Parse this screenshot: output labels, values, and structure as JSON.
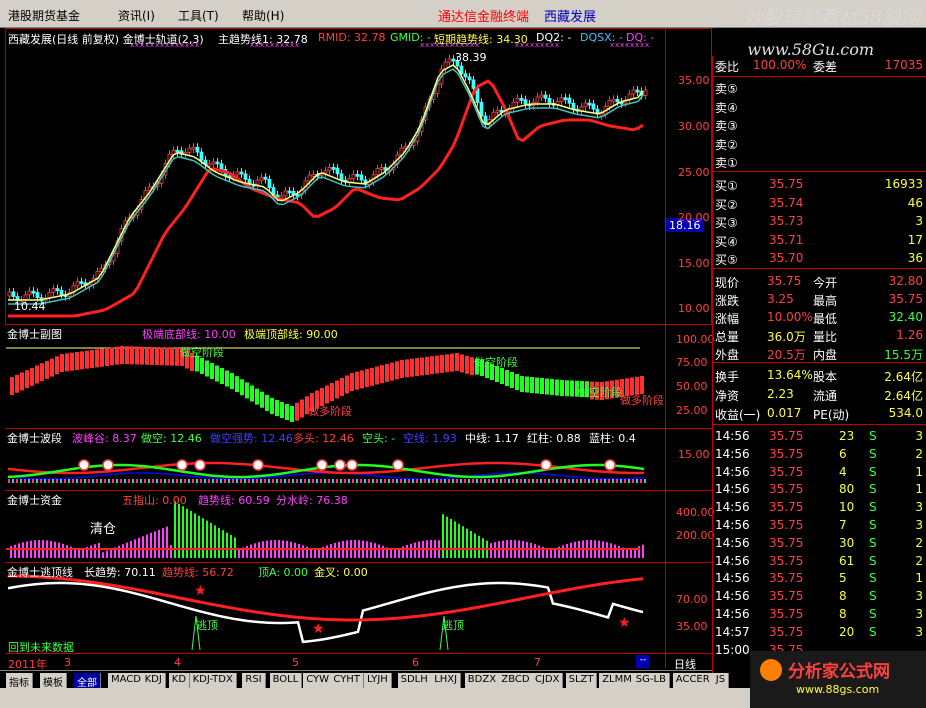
{
  "menu": {
    "items": [
      "港股期货基金",
      "资讯(I)",
      "工具(T)",
      "帮助(H)"
    ],
    "title_red": "通达信金融终端",
    "title_blue": "西藏发展"
  },
  "watermark": {
    "top": "炒股辅助教材58股网",
    "url": "www.58Gu.com",
    "logo_cn": "分析家公式网",
    "logo_url": "www.88gs.com"
  },
  "main_panel": {
    "title": "西藏发展(日线 前复权) 金博士轨道(2,3)",
    "trend_label": "主趋势线1: 32.78",
    "rmid": "RMID: 32.78",
    "gmid": "GMID: -",
    "short_trend": "短期趋势线: 34.30",
    "dq2": "DQ2: -",
    "dqsx": "DQSX: -",
    "dq": "DQ: -",
    "peak": "38.39",
    "low": "10.44",
    "price_marker": "18.16",
    "y_ticks": [
      "35.00",
      "30.00",
      "25.00",
      "20.00",
      "15.00",
      "10.00"
    ]
  },
  "sub1": {
    "title": "金博士副图",
    "low_line": "极端底部线: 10.00",
    "high_line": "极端顶部线: 90.00",
    "ann_empty1": "做空阶段",
    "ann_empty2": "做空阶段",
    "ann_empty3": "做空阶段",
    "ann_long1": "做多阶段",
    "ann_long2": "做多阶段",
    "y_ticks": [
      "100.00",
      "75.00",
      "50.00",
      "25.00"
    ]
  },
  "sub2": {
    "title": "金博士波段",
    "items": [
      {
        "t": "波峰谷: 8.37",
        "c": "#ff40ff"
      },
      {
        "t": "做空: 12.46",
        "c": "#40ff40"
      },
      {
        "t": "做空强势: 12.46",
        "c": "#4040ff"
      },
      {
        "t": "多头: 12.46",
        "c": "#ff4040"
      },
      {
        "t": "空头: -",
        "c": "#40ff40"
      },
      {
        "t": "空线: 1.93",
        "c": "#4040ff"
      },
      {
        "t": "中线: 1.17",
        "c": "#ffffff"
      },
      {
        "t": "红柱: 0.88",
        "c": "#ffffff"
      },
      {
        "t": "蓝柱: 0.4",
        "c": "#ffffff"
      }
    ],
    "y_tick": "15.00"
  },
  "sub3": {
    "title": "金博士资金",
    "wuzhi": "五指山: 0.00",
    "trend": "趋势线: 60.59",
    "fenshui": "分水岭: 76.38",
    "clear": "清仓",
    "y_ticks": [
      "400.00",
      "200.00"
    ]
  },
  "sub4": {
    "title": "金博士逃顶线",
    "long": "长趋势: 70.11",
    "trend": "趋势线: 56.72",
    "top": "顶A: 0.00",
    "golden": "金叉: 0.00",
    "flee1": "逃顶",
    "flee2": "逃顶",
    "bottom_text": "回到未来数据",
    "y_ticks": [
      "70.00",
      "35.00"
    ]
  },
  "time_axis": {
    "labels": [
      "2011年",
      "3",
      "4",
      "5",
      "6",
      "7"
    ],
    "period": "日线"
  },
  "tabs": [
    "指标",
    "模板",
    "全部",
    "MACD",
    "KDJ",
    "KD",
    "KDJ-TDX",
    "RSI",
    "BOLL",
    "CYW",
    "CYHT",
    "LYJH",
    "SDLH",
    "LHXJ",
    "BDZX",
    "ZBCD",
    "CJDX",
    "SLZT",
    "ZLMM",
    "SG-LB",
    "ACCER",
    "JS"
  ],
  "quote": {
    "wei": {
      "label": "委比",
      "pct": "100.00%",
      "diff_label": "委差",
      "diff": "17035"
    },
    "sells": [
      {
        "label": "卖⑤",
        "price": "",
        "vol": ""
      },
      {
        "label": "卖④",
        "price": "",
        "vol": ""
      },
      {
        "label": "卖③",
        "price": "",
        "vol": ""
      },
      {
        "label": "卖②",
        "price": "",
        "vol": ""
      },
      {
        "label": "卖①",
        "price": "",
        "vol": ""
      }
    ],
    "buys": [
      {
        "label": "买①",
        "price": "35.75",
        "vol": "16933"
      },
      {
        "label": "买②",
        "price": "35.74",
        "vol": "46"
      },
      {
        "label": "买③",
        "price": "35.73",
        "vol": "3"
      },
      {
        "label": "买④",
        "price": "35.71",
        "vol": "17"
      },
      {
        "label": "买⑤",
        "price": "35.70",
        "vol": "36"
      }
    ],
    "stats": [
      {
        "l1": "现价",
        "v1": "35.75",
        "c1": "#ff4040",
        "l2": "今开",
        "v2": "32.80",
        "c2": "#ff4040"
      },
      {
        "l1": "涨跌",
        "v1": "3.25",
        "c1": "#ff4040",
        "l2": "最高",
        "v2": "35.75",
        "c2": "#ff4040"
      },
      {
        "l1": "涨幅",
        "v1": "10.00%",
        "c1": "#ff4040",
        "l2": "最低",
        "v2": "32.40",
        "c2": "#40ff40"
      },
      {
        "l1": "总量",
        "v1": "36.0万",
        "c1": "#ffff40",
        "l2": "量比",
        "v2": "1.26",
        "c2": "#ff4040"
      },
      {
        "l1": "外盘",
        "v1": "20.5万",
        "c1": "#ff4040",
        "l2": "内盘",
        "v2": "15.5万",
        "c2": "#40ff40"
      }
    ],
    "stats2": [
      {
        "l1": "换手",
        "v1": "13.64%",
        "l2": "股本",
        "v2": "2.64亿"
      },
      {
        "l1": "净资",
        "v1": "2.23",
        "l2": "流通",
        "v2": "2.64亿"
      },
      {
        "l1": "收益(一)",
        "v1": "0.017",
        "l2": "PE(动)",
        "v2": "534.0"
      }
    ],
    "ticks": [
      {
        "time": "14:56",
        "price": "35.75",
        "vol": "23",
        "bs": "S",
        "n": "3"
      },
      {
        "time": "14:56",
        "price": "35.75",
        "vol": "6",
        "bs": "S",
        "n": "2"
      },
      {
        "time": "14:56",
        "price": "35.75",
        "vol": "4",
        "bs": "S",
        "n": "1"
      },
      {
        "time": "14:56",
        "price": "35.75",
        "vol": "80",
        "bs": "S",
        "n": "1"
      },
      {
        "time": "14:56",
        "price": "35.75",
        "vol": "10",
        "bs": "S",
        "n": "3"
      },
      {
        "time": "14:56",
        "price": "35.75",
        "vol": "7",
        "bs": "S",
        "n": "3"
      },
      {
        "time": "14:56",
        "price": "35.75",
        "vol": "30",
        "bs": "S",
        "n": "2"
      },
      {
        "time": "14:56",
        "price": "35.75",
        "vol": "61",
        "bs": "S",
        "n": "2"
      },
      {
        "time": "14:56",
        "price": "35.75",
        "vol": "5",
        "bs": "S",
        "n": "1"
      },
      {
        "time": "14:56",
        "price": "35.75",
        "vol": "8",
        "bs": "S",
        "n": "3"
      },
      {
        "time": "14:56",
        "price": "35.75",
        "vol": "8",
        "bs": "S",
        "n": "3"
      },
      {
        "time": "14:57",
        "price": "35.75",
        "vol": "20",
        "bs": "S",
        "n": "3"
      },
      {
        "time": "15:00",
        "price": "35.75",
        "vol": "",
        "bs": "",
        "n": ""
      }
    ]
  }
}
